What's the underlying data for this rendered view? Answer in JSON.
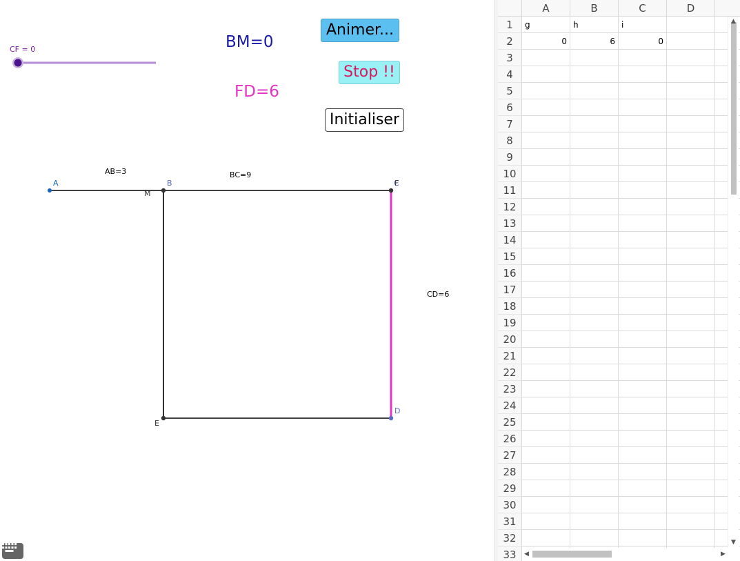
{
  "graphics": {
    "slider": {
      "label": "CF = 0",
      "value": 0,
      "color": "#7b1fa2"
    },
    "texts": {
      "bm": "BM=0",
      "fd": "FD=6",
      "ab": "AB=3",
      "bc": "BC=9",
      "cd": "CD=6"
    },
    "buttons": {
      "animate": "Animer...",
      "stop": "Stop !!",
      "reset": "Initialiser"
    },
    "points": {
      "A": "A",
      "B": "B",
      "M": "M",
      "C": "C",
      "F": "F",
      "D": "D",
      "E": "E"
    },
    "colors": {
      "point_blue": "#1565c0",
      "segment_pink": "#e533c5",
      "text_darkblue": "#1a1aa6",
      "text_pink": "#e533c5",
      "stop_text": "#d81b60",
      "animate_bg": "#5bc0f0",
      "stop_bg": "#99f0f5"
    }
  },
  "spreadsheet": {
    "columns": [
      "A",
      "B",
      "C",
      "D"
    ],
    "rows": [
      "1",
      "2",
      "3",
      "4",
      "5",
      "6",
      "7",
      "8",
      "9",
      "10",
      "11",
      "12",
      "13",
      "14",
      "15",
      "16",
      "17",
      "18",
      "19",
      "20",
      "21",
      "22",
      "23",
      "24",
      "25",
      "26",
      "27",
      "28",
      "29",
      "30",
      "31",
      "32",
      "33"
    ],
    "cells": {
      "A1": "g",
      "B1": "h",
      "C1": "i",
      "A2": "0",
      "B2": "6",
      "C2": "0"
    }
  },
  "icons": {
    "keyboard": "keyboard-icon",
    "scroll_up": "arrow-up-icon",
    "scroll_down": "arrow-down-icon",
    "scroll_left": "arrow-left-icon",
    "scroll_right": "arrow-right-icon"
  }
}
